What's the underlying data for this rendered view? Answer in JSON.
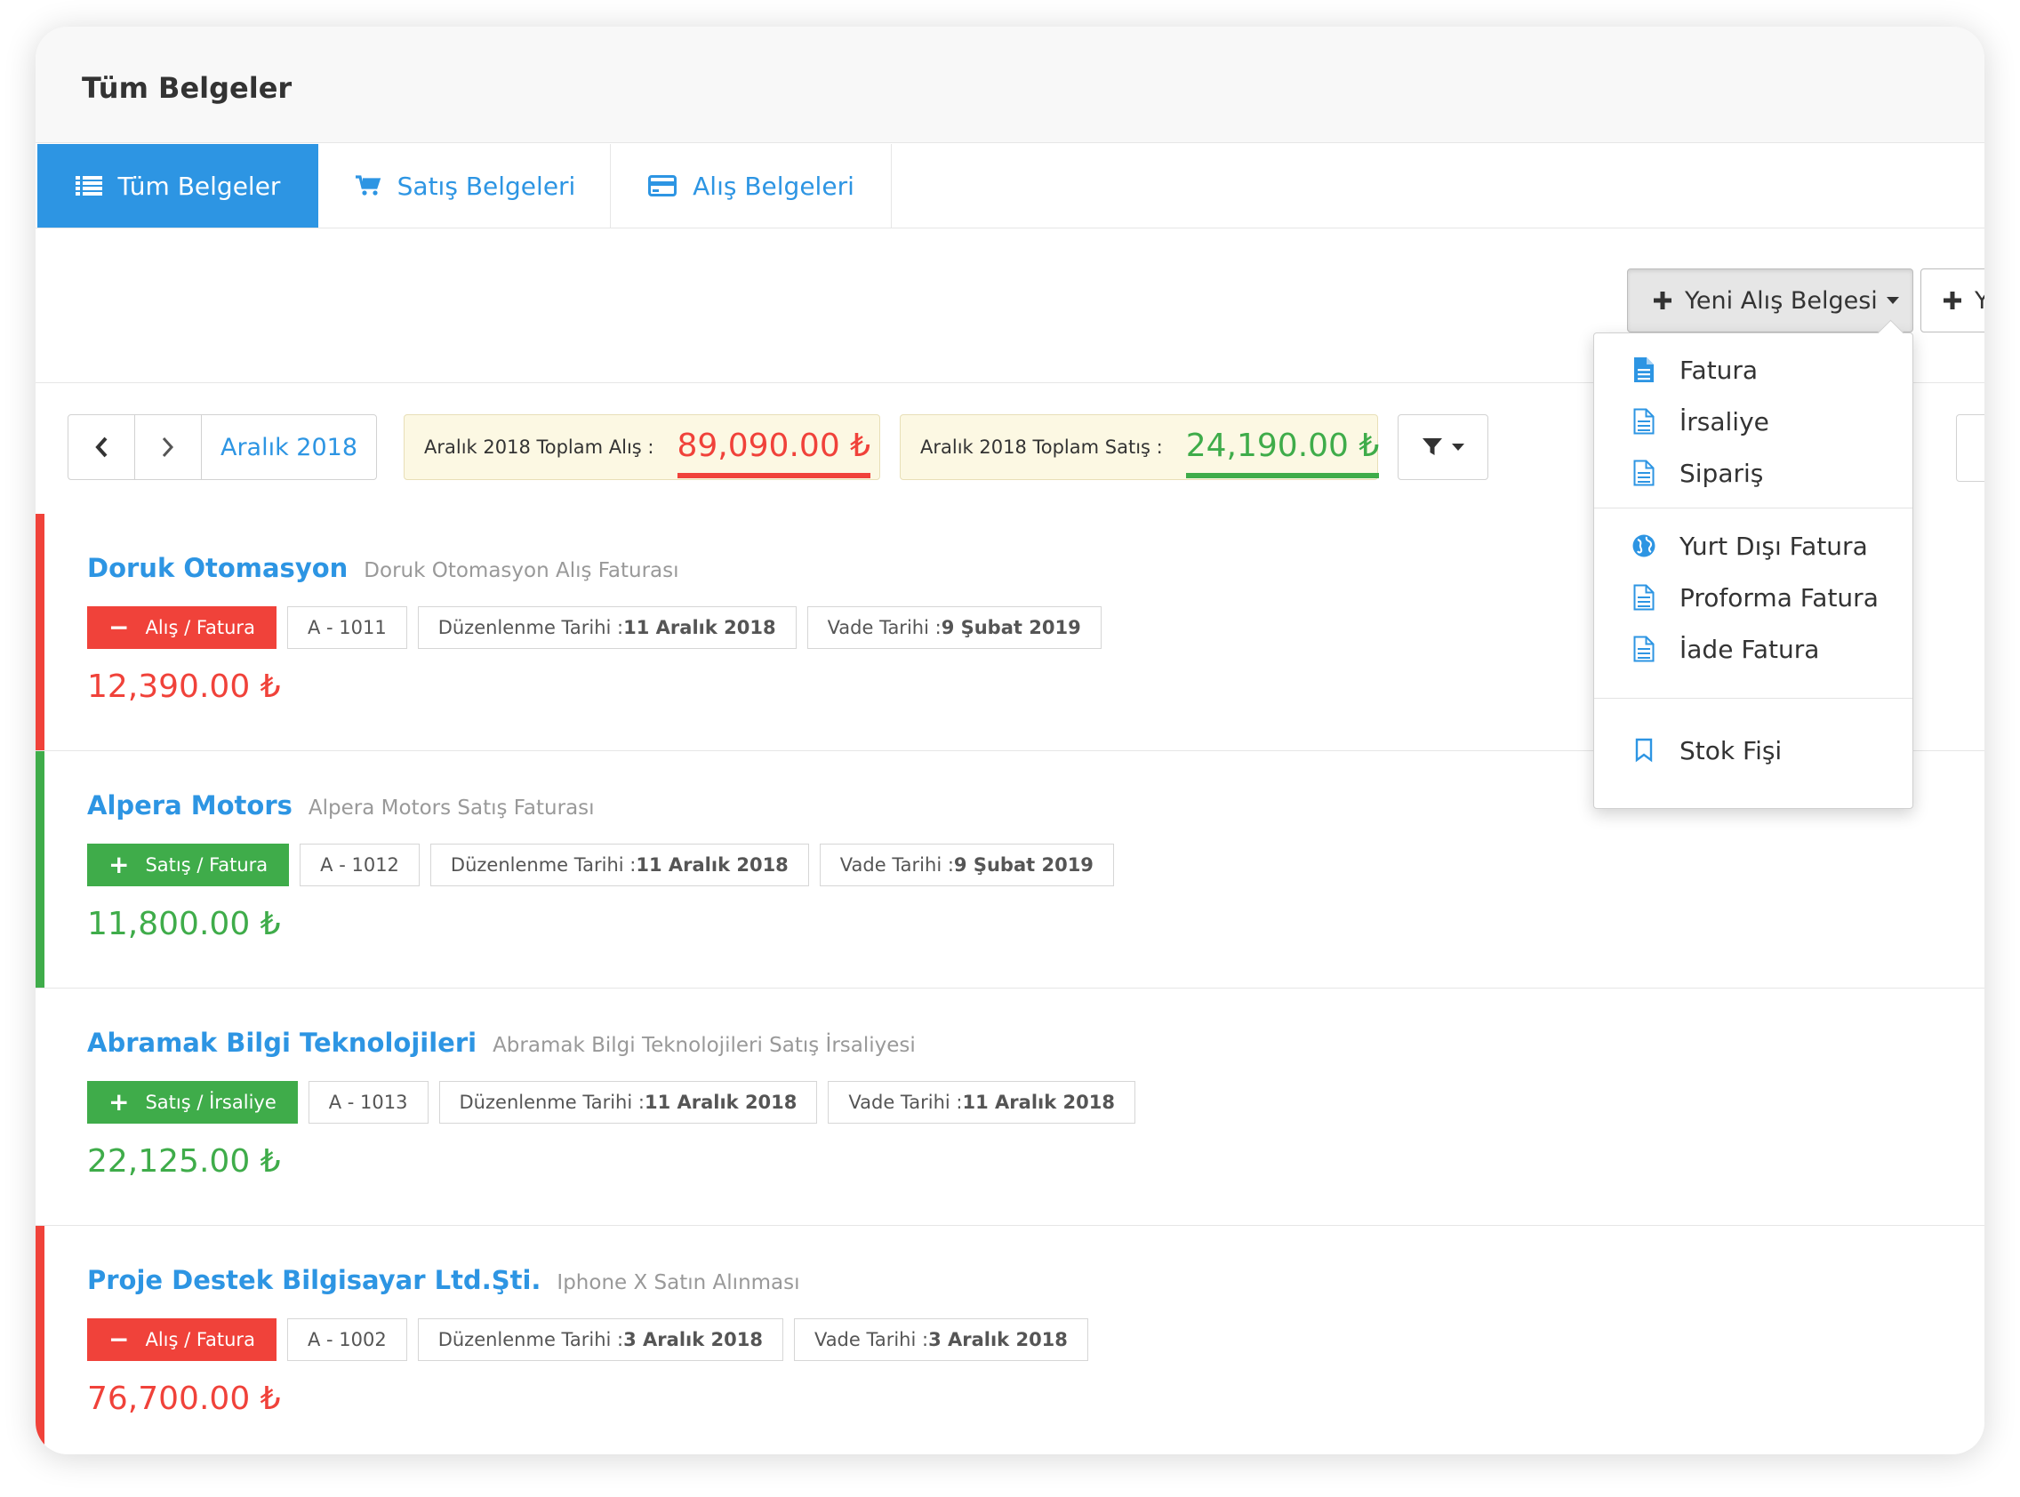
{
  "header": {
    "title": "Tüm Belgeler"
  },
  "tabs": [
    {
      "label": "Tüm Belgeler",
      "icon": "list-icon",
      "active": true
    },
    {
      "label": "Satış Belgeleri",
      "icon": "cart-icon",
      "active": false
    },
    {
      "label": "Alış Belgeleri",
      "icon": "credit-card-icon",
      "active": false
    }
  ],
  "toolbar": {
    "new_purchase_label": "Yeni Alış Belgesi",
    "new_sales_label": "Y"
  },
  "filters": {
    "month_label": "Aralık 2018",
    "total_purchase_label": "Aralık 2018 Toplam Alış :",
    "total_purchase_value": "89,090.00 ₺",
    "total_sales_label": "Aralık 2018 Toplam Satış :",
    "total_sales_value": "24,190.00 ₺"
  },
  "dropdown": {
    "items": [
      {
        "label": "Fatura",
        "icon": "file-text-solid-icon"
      },
      {
        "label": "İrsaliye",
        "icon": "file-text-icon"
      },
      {
        "label": "Sipariş",
        "icon": "file-text-icon"
      },
      {
        "label": "Yurt Dışı Fatura",
        "icon": "globe-icon"
      },
      {
        "label": "Proforma Fatura",
        "icon": "file-text-icon"
      },
      {
        "label": "İade Fatura",
        "icon": "file-text-icon"
      },
      {
        "label": "Stok Fişi",
        "icon": "bookmark-icon"
      }
    ]
  },
  "documents": [
    {
      "company": "Doruk Otomasyon",
      "description": "Doruk Otomasyon Alış Faturası",
      "type_label": "Alış / Fatura",
      "kind": "purchase",
      "number": "A - 1011",
      "issue_label": "Düzenlenme Tarihi : ",
      "issue_date": "11 Aralık 2018",
      "due_label": "Vade Tarihi : ",
      "due_date": "9 Şubat 2019",
      "amount": "12,390.00 ₺"
    },
    {
      "company": "Alpera Motors",
      "description": "Alpera Motors Satış Faturası",
      "type_label": "Satış / Fatura",
      "kind": "sale",
      "number": "A - 1012",
      "issue_label": "Düzenlenme Tarihi : ",
      "issue_date": "11 Aralık 2018",
      "due_label": "Vade Tarihi : ",
      "due_date": "9 Şubat 2019",
      "amount": "11,800.00 ₺"
    },
    {
      "company": "Abramak Bilgi Teknolojileri",
      "description": "Abramak Bilgi Teknolojileri Satış İrsaliyesi",
      "type_label": "Satış / İrsaliye",
      "kind": "sale",
      "bar": "none",
      "number": "A - 1013",
      "issue_label": "Düzenlenme Tarihi : ",
      "issue_date": "11 Aralık 2018",
      "due_label": "Vade Tarihi : ",
      "due_date": "11 Aralık 2018",
      "amount": "22,125.00 ₺"
    },
    {
      "company": "Proje Destek Bilgisayar Ltd.Şti.",
      "description": "Iphone X Satın Alınması",
      "type_label": "Alış / Fatura",
      "kind": "purchase",
      "number": "A - 1002",
      "issue_label": "Düzenlenme Tarihi : ",
      "issue_date": "3 Aralık 2018",
      "due_label": "Vade Tarihi : ",
      "due_date": "3 Aralık 2018",
      "amount": "76,700.00 ₺"
    }
  ],
  "colors": {
    "accent": "#2d95e3",
    "purchase_red": "#f0423a",
    "sale_green": "#3fac4a",
    "total_box_bg": "#fcf8e3"
  }
}
